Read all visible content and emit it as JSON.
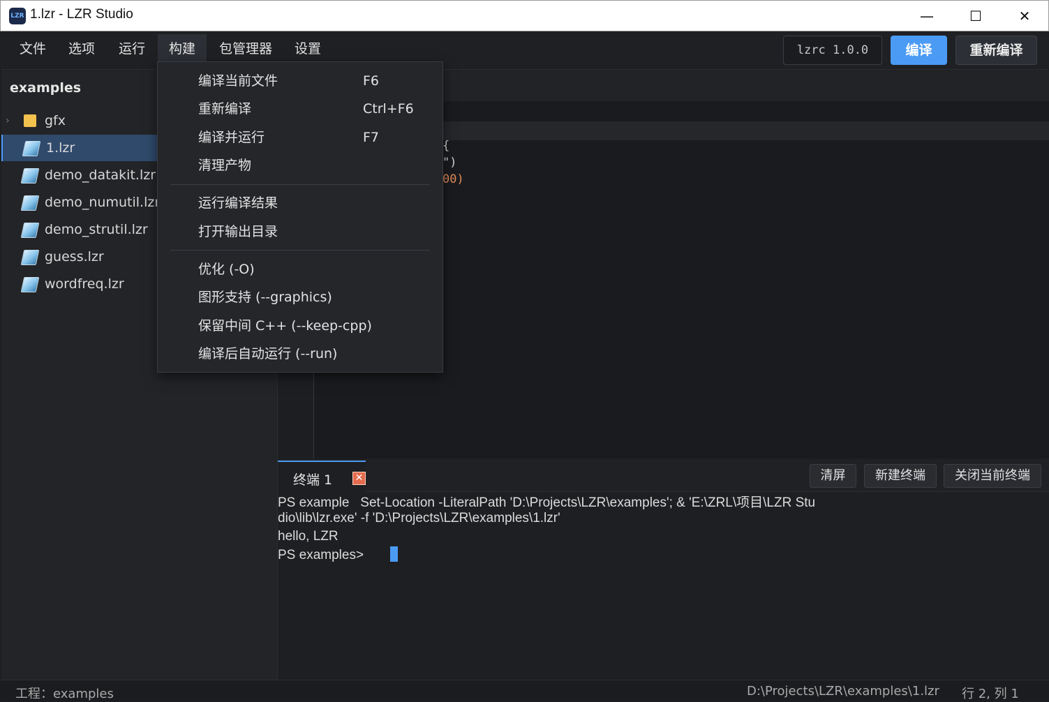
{
  "window": {
    "title": "1.lzr - LZR Studio",
    "logo_text": "LZR",
    "minimize": "—",
    "maximize": "☐",
    "close": "✕"
  },
  "menubar": {
    "items": [
      "文件",
      "选项",
      "运行",
      "构建",
      "包管理器",
      "设置"
    ],
    "active_index": 3
  },
  "toolbar": {
    "version": "lzrc 1.0.0",
    "compile_label": "编译",
    "recompile_label": "重新编译"
  },
  "sidebar": {
    "title": "examples",
    "items": [
      {
        "label": "gfx",
        "type": "folder"
      },
      {
        "label": "1.lzr",
        "type": "file",
        "selected": true
      },
      {
        "label": "demo_datakit.lzr",
        "type": "file"
      },
      {
        "label": "demo_numutil.lzr",
        "type": "file"
      },
      {
        "label": "demo_strutil.lzr",
        "type": "file"
      },
      {
        "label": "guess.lzr",
        "type": "file"
      },
      {
        "label": "wordfreq.lzr",
        "type": "file"
      }
    ]
  },
  "editor": {
    "visible_fragments": [
      "{",
      "\")",
      "00)"
    ]
  },
  "build_menu": {
    "items": [
      {
        "label": "编译当前文件",
        "shortcut": "F6"
      },
      {
        "label": "重新编译",
        "shortcut": "Ctrl+F6"
      },
      {
        "label": "编译并运行",
        "shortcut": "F7"
      },
      {
        "label": "清理产物",
        "shortcut": ""
      },
      {
        "label": "运行编译结果",
        "shortcut": ""
      },
      {
        "label": "打开输出目录",
        "shortcut": ""
      },
      {
        "label": "优化 (-O)",
        "shortcut": ""
      },
      {
        "label": "图形支持 (--graphics)",
        "shortcut": ""
      },
      {
        "label": "保留中间 C++ (--keep-cpp)",
        "shortcut": ""
      },
      {
        "label": "编译后自动运行 (--run)",
        "shortcut": ""
      }
    ]
  },
  "terminal": {
    "tab_label": "终端 1",
    "tab_close": "✕",
    "clear_label": "清屏",
    "new_label": "新建终端",
    "close_current_label": "关闭当前终端",
    "lines": [
      "PS example   Set-Location -LiteralPath 'D:\\Projects\\LZR\\examples'; & 'E:\\ZRL\\项目\\LZR Stu",
      "dio\\lib\\lzr.exe' -f 'D:\\Projects\\LZR\\examples\\1.lzr'",
      "hello, LZR",
      "PS examples>"
    ]
  },
  "statusbar": {
    "project": "工程：examples",
    "path": "D:\\Projects\\LZR\\examples\\1.lzr",
    "position": "行 2, 列 1"
  },
  "colors": {
    "accent": "#4b9bf5",
    "close_badge": "#e46b4e"
  }
}
